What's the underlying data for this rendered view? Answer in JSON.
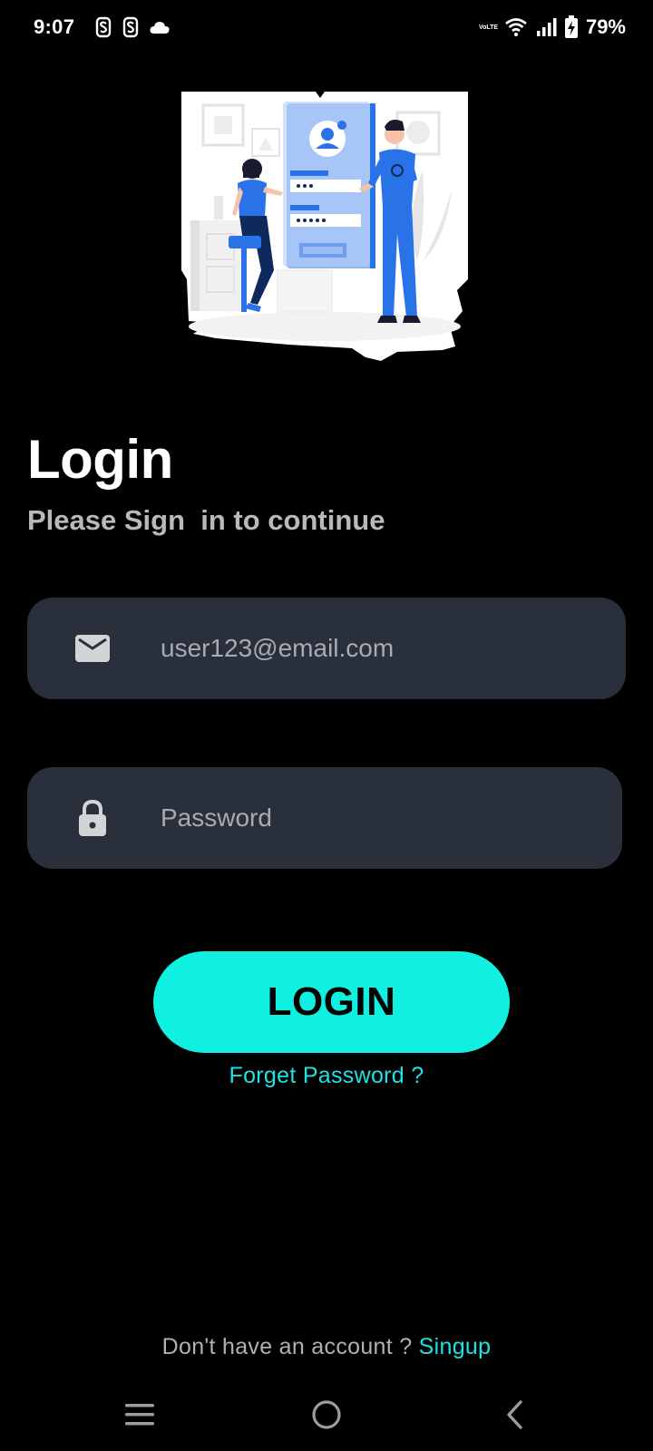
{
  "status_bar": {
    "time": "9:07",
    "left_icons": [
      "notification-s-icon",
      "notification-s-icon",
      "cloud-icon"
    ],
    "volte": "VoLTE",
    "battery": "79%"
  },
  "illustration": {
    "name": "login-illustration",
    "colors": {
      "accent": "#2a72e8",
      "light": "#8fb4f5",
      "dark": "#0e2a5c",
      "bg": "#ffffff"
    }
  },
  "header": {
    "title": "Login",
    "subtitle": "Please Sign  in to continue"
  },
  "form": {
    "email_icon": "mail-icon",
    "email_placeholder": "user123@email.com",
    "password_icon": "lock-icon",
    "password_placeholder": "Password"
  },
  "actions": {
    "login_label": "LOGIN",
    "forget_password": "Forget Password ?",
    "no_account_text": "Don't have an account ? ",
    "signup_label": "Singup"
  },
  "nav": {
    "items": [
      "menu-icon",
      "home-icon",
      "back-icon"
    ]
  },
  "colors": {
    "background": "#000000",
    "field_bg": "#29303b",
    "accent": "#0ff0e0",
    "link": "#1de3e3"
  }
}
